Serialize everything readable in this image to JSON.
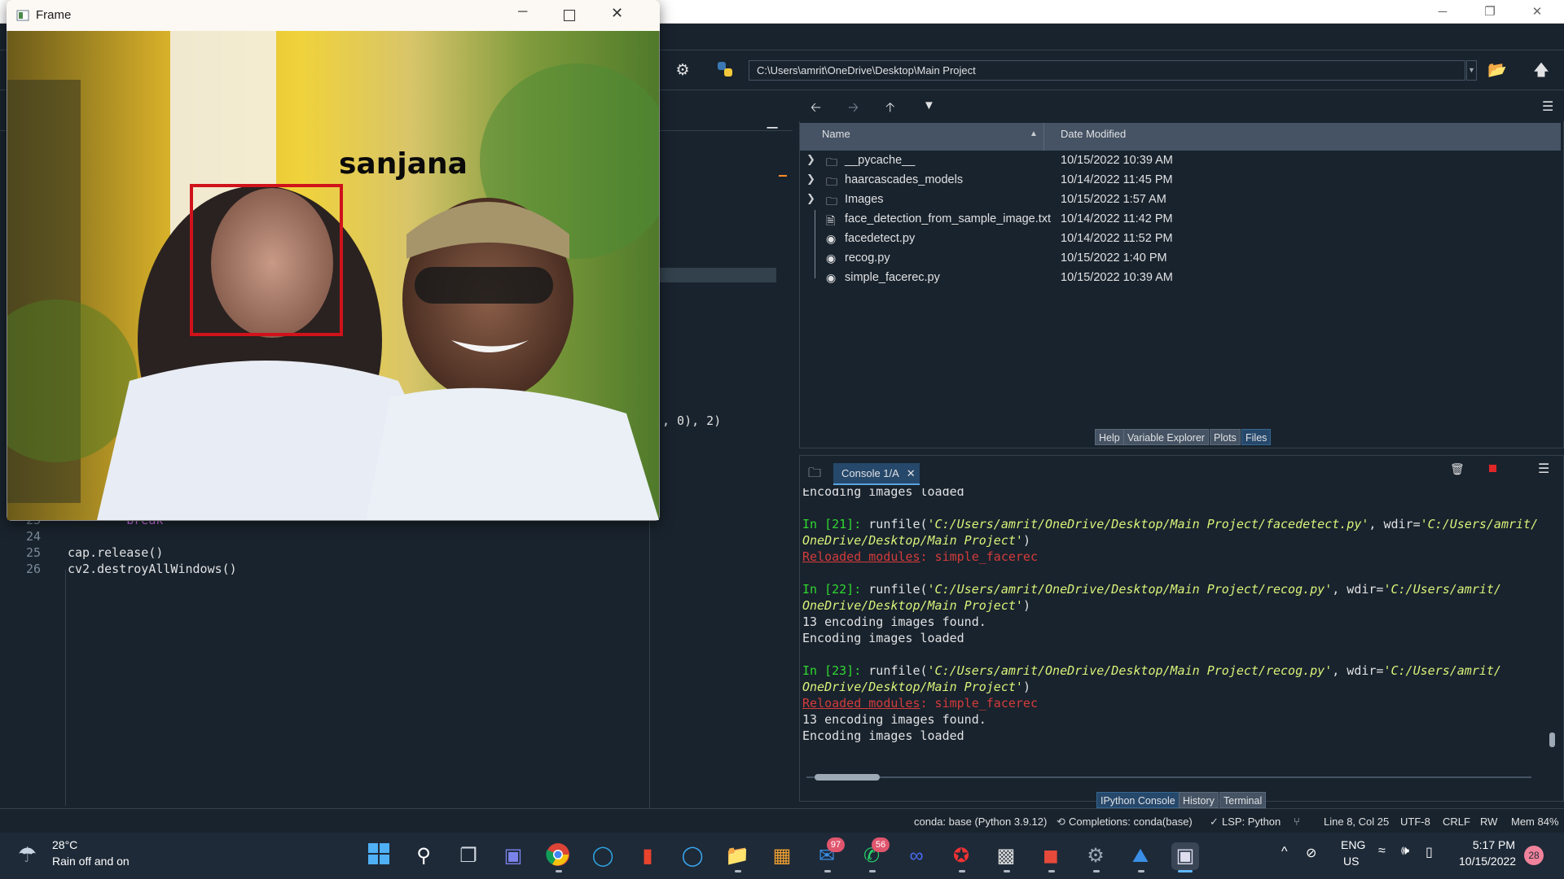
{
  "window": {
    "minimize": "─",
    "maximize": "❐",
    "close": "✕"
  },
  "toolbar": {
    "path": "C:\\Users\\amrit\\OneDrive\\Desktop\\Main Project"
  },
  "editor": {
    "lines": [
      {
        "num": "23",
        "code": "        break"
      },
      {
        "num": "24",
        "code": ""
      },
      {
        "num": "25",
        "code": "cap.release()"
      },
      {
        "num": "26",
        "code": "cv2.destroyAllWindows()"
      }
    ],
    "visible_fragment": ", 0), 2)"
  },
  "files": {
    "col_name": "Name",
    "col_date": "Date Modified",
    "rows": [
      {
        "name": "__pycache__",
        "date": "10/15/2022 10:39 AM",
        "type": "folder"
      },
      {
        "name": "haarcascades_models",
        "date": "10/14/2022 11:45 PM",
        "type": "folder"
      },
      {
        "name": "Images",
        "date": "10/15/2022 1:57 AM",
        "type": "folder"
      },
      {
        "name": "face_detection_from_sample_image.txt",
        "date": "10/14/2022 11:42 PM",
        "type": "text"
      },
      {
        "name": "facedetect.py",
        "date": "10/14/2022 11:52 PM",
        "type": "python"
      },
      {
        "name": "recog.py",
        "date": "10/15/2022 1:40 PM",
        "type": "python"
      },
      {
        "name": "simple_facerec.py",
        "date": "10/15/2022 10:39 AM",
        "type": "python"
      }
    ],
    "tabs": [
      "Help",
      "Variable Explorer",
      "Plots",
      "Files"
    ],
    "active_tab": "Files"
  },
  "console": {
    "tab_label": "Console 1/A",
    "output_tabs": [
      "IPython Console",
      "History",
      "Terminal"
    ],
    "line_loaded_1": "Encoding images loaded",
    "in21_prompt": "In [21]:",
    "in21_cmd": " runfile(",
    "in21_arg1": "'C:/Users/amrit/OneDrive/Desktop/Main Project/facedetect.py'",
    "in21_sep": ", wdir=",
    "in21_arg2a": "'C:/Users/amrit/",
    "in21_arg2b": "OneDrive/Desktop/Main Project'",
    "close_paren": ")",
    "reloaded_label": "Reloaded modules",
    "reloaded_value": ": simple_facerec",
    "in22_prompt": "In [22]:",
    "in22_arg1": "'C:/Users/amrit/OneDrive/Desktop/Main Project/recog.py'",
    "found": "13 encoding images found.",
    "loaded": "Encoding images loaded",
    "in23_prompt": "In [23]:"
  },
  "statusbar": {
    "env": "conda: base (Python 3.9.12)",
    "completions": "Completions: conda(base)",
    "lsp": "LSP: Python",
    "position": "Line 8, Col 25",
    "encoding": "UTF-8",
    "eol": "CRLF",
    "rw": "RW",
    "mem": "Mem 84%"
  },
  "frame": {
    "title": "Frame",
    "label": "sanjana"
  },
  "taskbar": {
    "weather_temp": "28°C",
    "weather_desc": "Rain off and on",
    "lang": "ENG",
    "region": "US",
    "time": "5:17 PM",
    "date": "10/15/2022",
    "notif_count": "28",
    "mail_badge": "97",
    "whatsapp_badge": "56"
  },
  "colors": {
    "spyder_bg": "#19232d",
    "panel_header": "#455364",
    "accent": "#26486b",
    "prompt_green": "#30d830",
    "string_yellow": "#d9f27a",
    "error_red": "#d33b3b",
    "face_box": "#d0121b"
  }
}
